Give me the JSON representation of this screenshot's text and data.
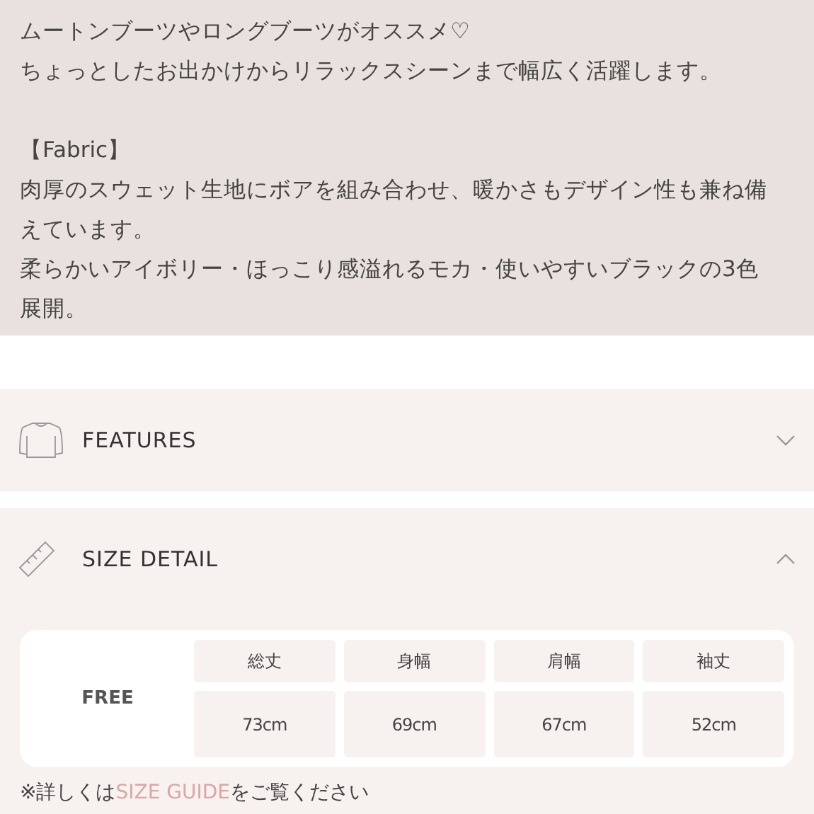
{
  "description": {
    "paragraphs": [
      {
        "lines": [
          "ムートンブーツやロングブーツがオススメ♡",
          "ちょっとしたお出かけからリラックスシーンまで幅広く活躍します。"
        ]
      },
      {
        "lines": [
          "【Fabric】",
          "肉厚のスウェット生地にボアを組み合わせ、暖かさもデザイン性も兼ね備えています。",
          "柔らかいアイボリー・ほっこり感溢れるモカ・使いやすいブラックの3色展開。"
        ]
      }
    ]
  },
  "sections": [
    {
      "kind": "features",
      "title": "FEATURES",
      "expanded": false
    },
    {
      "kind": "size",
      "title": "SIZE DETAIL",
      "expanded": true,
      "size_table": {
        "size": "FREE",
        "columns": [
          "総丈",
          "身幅",
          "肩幅",
          "袖丈"
        ],
        "values": [
          "73cm",
          "69cm",
          "67cm",
          "52cm"
        ]
      },
      "note": {
        "before": "※詳しくは",
        "link": "SIZE GUIDE",
        "after": "をご覧ください"
      }
    }
  ]
}
